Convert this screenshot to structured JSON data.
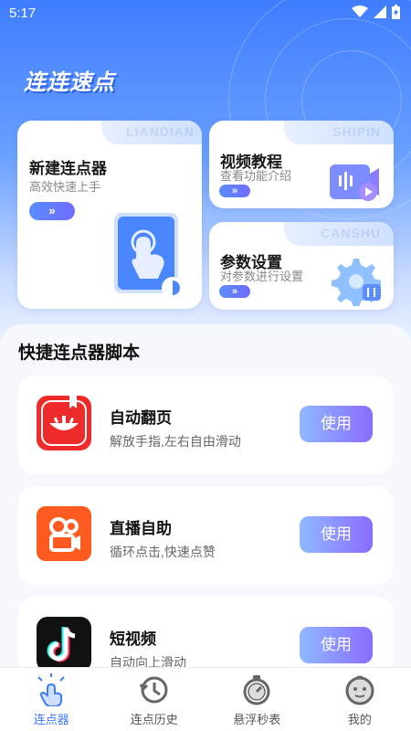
{
  "status_bar": {
    "time": "5:17"
  },
  "app": {
    "logo_text": "连连速点"
  },
  "cards": {
    "new_clicker": {
      "title": "新建连点器",
      "subtitle": "高效快速上手",
      "watermark": "LIANDIAN"
    },
    "video_tutorial": {
      "title": "视频教程",
      "subtitle": "查看功能介绍",
      "watermark": "SHIPIN"
    },
    "param_settings": {
      "title": "参数设置",
      "subtitle": "对参数进行设置",
      "watermark": "CANSHU"
    }
  },
  "section": {
    "title": "快捷连点器脚本"
  },
  "scripts": [
    {
      "name": "自动翻页",
      "desc": "解放手指,左右自由滑动",
      "button": "使用",
      "icon": "book-icon"
    },
    {
      "name": "直播自助",
      "desc": "循环点击,快速点赞",
      "button": "使用",
      "icon": "kuaishou-icon"
    },
    {
      "name": "短视频",
      "desc": "自动向上滑动",
      "button": "使用",
      "icon": "tiktok-icon"
    }
  ],
  "tabbar": {
    "items": [
      {
        "label": "连点器",
        "icon": "tap-icon",
        "active": true
      },
      {
        "label": "连点历史",
        "icon": "history-icon",
        "active": false
      },
      {
        "label": "悬浮秒表",
        "icon": "stopwatch-icon",
        "active": false
      },
      {
        "label": "我的",
        "icon": "profile-icon",
        "active": false
      }
    ]
  },
  "colors": {
    "accent": "#3d7bff",
    "hero_top": "#3f7dff"
  }
}
